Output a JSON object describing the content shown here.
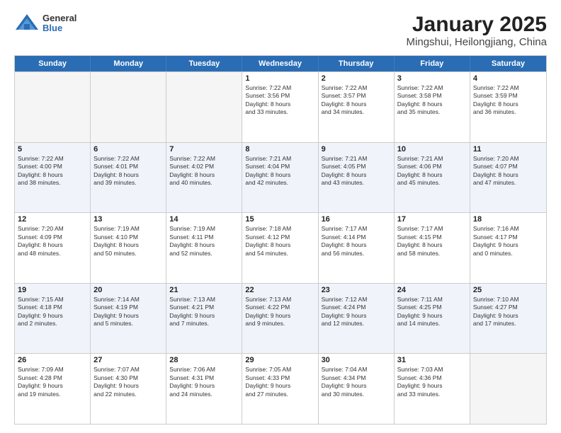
{
  "logo": {
    "general": "General",
    "blue": "Blue"
  },
  "title": "January 2025",
  "subtitle": "Mingshui, Heilongjiang, China",
  "header": {
    "days": [
      "Sunday",
      "Monday",
      "Tuesday",
      "Wednesday",
      "Thursday",
      "Friday",
      "Saturday"
    ]
  },
  "weeks": [
    [
      {
        "day": "",
        "info": ""
      },
      {
        "day": "",
        "info": ""
      },
      {
        "day": "",
        "info": ""
      },
      {
        "day": "1",
        "info": "Sunrise: 7:22 AM\nSunset: 3:56 PM\nDaylight: 8 hours\nand 33 minutes."
      },
      {
        "day": "2",
        "info": "Sunrise: 7:22 AM\nSunset: 3:57 PM\nDaylight: 8 hours\nand 34 minutes."
      },
      {
        "day": "3",
        "info": "Sunrise: 7:22 AM\nSunset: 3:58 PM\nDaylight: 8 hours\nand 35 minutes."
      },
      {
        "day": "4",
        "info": "Sunrise: 7:22 AM\nSunset: 3:59 PM\nDaylight: 8 hours\nand 36 minutes."
      }
    ],
    [
      {
        "day": "5",
        "info": "Sunrise: 7:22 AM\nSunset: 4:00 PM\nDaylight: 8 hours\nand 38 minutes."
      },
      {
        "day": "6",
        "info": "Sunrise: 7:22 AM\nSunset: 4:01 PM\nDaylight: 8 hours\nand 39 minutes."
      },
      {
        "day": "7",
        "info": "Sunrise: 7:22 AM\nSunset: 4:02 PM\nDaylight: 8 hours\nand 40 minutes."
      },
      {
        "day": "8",
        "info": "Sunrise: 7:21 AM\nSunset: 4:04 PM\nDaylight: 8 hours\nand 42 minutes."
      },
      {
        "day": "9",
        "info": "Sunrise: 7:21 AM\nSunset: 4:05 PM\nDaylight: 8 hours\nand 43 minutes."
      },
      {
        "day": "10",
        "info": "Sunrise: 7:21 AM\nSunset: 4:06 PM\nDaylight: 8 hours\nand 45 minutes."
      },
      {
        "day": "11",
        "info": "Sunrise: 7:20 AM\nSunset: 4:07 PM\nDaylight: 8 hours\nand 47 minutes."
      }
    ],
    [
      {
        "day": "12",
        "info": "Sunrise: 7:20 AM\nSunset: 4:09 PM\nDaylight: 8 hours\nand 48 minutes."
      },
      {
        "day": "13",
        "info": "Sunrise: 7:19 AM\nSunset: 4:10 PM\nDaylight: 8 hours\nand 50 minutes."
      },
      {
        "day": "14",
        "info": "Sunrise: 7:19 AM\nSunset: 4:11 PM\nDaylight: 8 hours\nand 52 minutes."
      },
      {
        "day": "15",
        "info": "Sunrise: 7:18 AM\nSunset: 4:12 PM\nDaylight: 8 hours\nand 54 minutes."
      },
      {
        "day": "16",
        "info": "Sunrise: 7:17 AM\nSunset: 4:14 PM\nDaylight: 8 hours\nand 56 minutes."
      },
      {
        "day": "17",
        "info": "Sunrise: 7:17 AM\nSunset: 4:15 PM\nDaylight: 8 hours\nand 58 minutes."
      },
      {
        "day": "18",
        "info": "Sunrise: 7:16 AM\nSunset: 4:17 PM\nDaylight: 9 hours\nand 0 minutes."
      }
    ],
    [
      {
        "day": "19",
        "info": "Sunrise: 7:15 AM\nSunset: 4:18 PM\nDaylight: 9 hours\nand 2 minutes."
      },
      {
        "day": "20",
        "info": "Sunrise: 7:14 AM\nSunset: 4:19 PM\nDaylight: 9 hours\nand 5 minutes."
      },
      {
        "day": "21",
        "info": "Sunrise: 7:13 AM\nSunset: 4:21 PM\nDaylight: 9 hours\nand 7 minutes."
      },
      {
        "day": "22",
        "info": "Sunrise: 7:13 AM\nSunset: 4:22 PM\nDaylight: 9 hours\nand 9 minutes."
      },
      {
        "day": "23",
        "info": "Sunrise: 7:12 AM\nSunset: 4:24 PM\nDaylight: 9 hours\nand 12 minutes."
      },
      {
        "day": "24",
        "info": "Sunrise: 7:11 AM\nSunset: 4:25 PM\nDaylight: 9 hours\nand 14 minutes."
      },
      {
        "day": "25",
        "info": "Sunrise: 7:10 AM\nSunset: 4:27 PM\nDaylight: 9 hours\nand 17 minutes."
      }
    ],
    [
      {
        "day": "26",
        "info": "Sunrise: 7:09 AM\nSunset: 4:28 PM\nDaylight: 9 hours\nand 19 minutes."
      },
      {
        "day": "27",
        "info": "Sunrise: 7:07 AM\nSunset: 4:30 PM\nDaylight: 9 hours\nand 22 minutes."
      },
      {
        "day": "28",
        "info": "Sunrise: 7:06 AM\nSunset: 4:31 PM\nDaylight: 9 hours\nand 24 minutes."
      },
      {
        "day": "29",
        "info": "Sunrise: 7:05 AM\nSunset: 4:33 PM\nDaylight: 9 hours\nand 27 minutes."
      },
      {
        "day": "30",
        "info": "Sunrise: 7:04 AM\nSunset: 4:34 PM\nDaylight: 9 hours\nand 30 minutes."
      },
      {
        "day": "31",
        "info": "Sunrise: 7:03 AM\nSunset: 4:36 PM\nDaylight: 9 hours\nand 33 minutes."
      },
      {
        "day": "",
        "info": ""
      }
    ]
  ]
}
